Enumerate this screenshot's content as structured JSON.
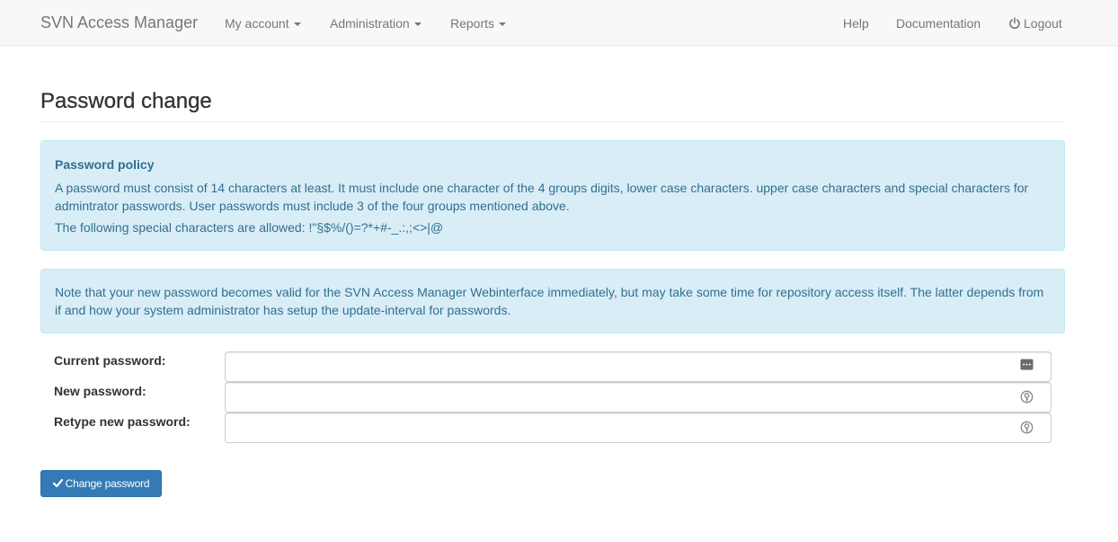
{
  "navbar": {
    "brand": "SVN Access Manager",
    "left_menu": [
      {
        "label": "My account",
        "icon": "caret-down-icon"
      },
      {
        "label": "Administration",
        "icon": "caret-down-icon"
      },
      {
        "label": "Reports",
        "icon": "caret-down-icon"
      }
    ],
    "right_menu": {
      "help": "Help",
      "documentation": "Documentation",
      "logout": "Logout",
      "logout_icon": "power-icon"
    }
  },
  "page": {
    "title": "Password change"
  },
  "policy_alert": {
    "heading": "Password policy",
    "text": "A password must consist of 14 characters at least. It must include one character of the 4 groups digits, lower case characters. upper case characters and special characters for admintrator passwords. User passwords must include 3 of the four groups mentioned above.",
    "special_chars": "The following special characters are allowed: !\"§$%/()=?*+#-_.:,;<>|@"
  },
  "note_alert": {
    "text": "Note that your new password becomes valid for the SVN Access Manager Webinterface immediately, but may take some time for repository access itself. The latter depends from if and how your system administrator has setup the update-interval for passwords."
  },
  "form": {
    "fields": [
      {
        "label": "Current password:",
        "value": "",
        "placeholder": "",
        "icon": "password-manager-icon"
      },
      {
        "label": "New password:",
        "value": "",
        "placeholder": "",
        "icon": "key-fill-icon"
      },
      {
        "label": "Retype new password:",
        "value": "",
        "placeholder": "",
        "icon": "key-fill-icon"
      }
    ],
    "submit_label": "Change password",
    "submit_icon": "check-icon"
  },
  "colors": {
    "navbar_bg": "#f8f8f8",
    "nav_text": "#777777",
    "alert_bg": "#d9edf7",
    "alert_border": "#bce8f1",
    "alert_text": "#31708f",
    "primary_button": "#337ab7"
  }
}
